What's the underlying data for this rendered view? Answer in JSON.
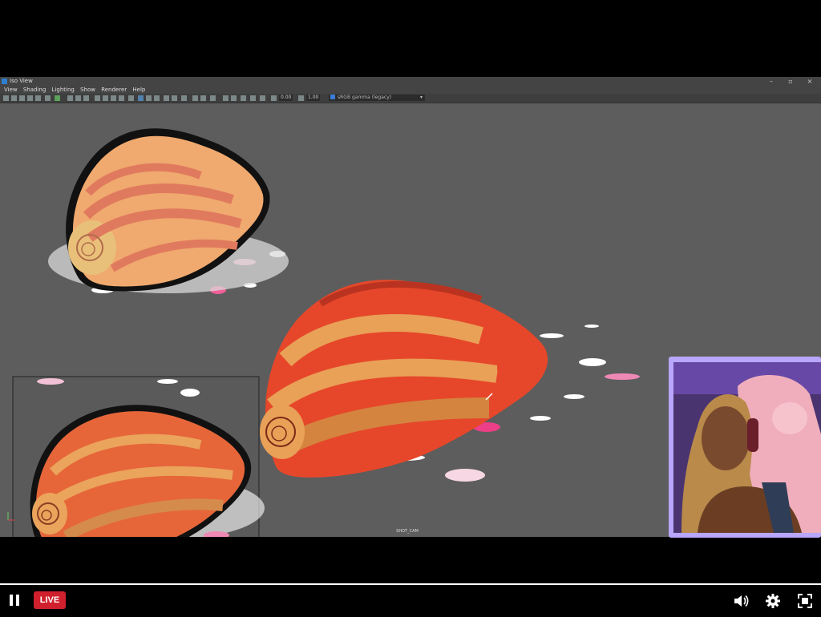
{
  "maya": {
    "title": "Iso View",
    "menus": [
      "View",
      "Shading",
      "Lighting",
      "Show",
      "Renderer",
      "Help"
    ],
    "toolbar": {
      "field_a": "0.00",
      "field_b": "1.00",
      "color_space": "sRGB gamma (legacy)"
    },
    "camera_label": "SHOT_CAM"
  },
  "player": {
    "live_label": "LIVE",
    "icons": [
      "pause-icon",
      "volume-icon",
      "settings-icon",
      "fullscreen-icon"
    ],
    "live_color": "#d0202d"
  },
  "webcam": {
    "border_color": "#b9a6ff"
  }
}
